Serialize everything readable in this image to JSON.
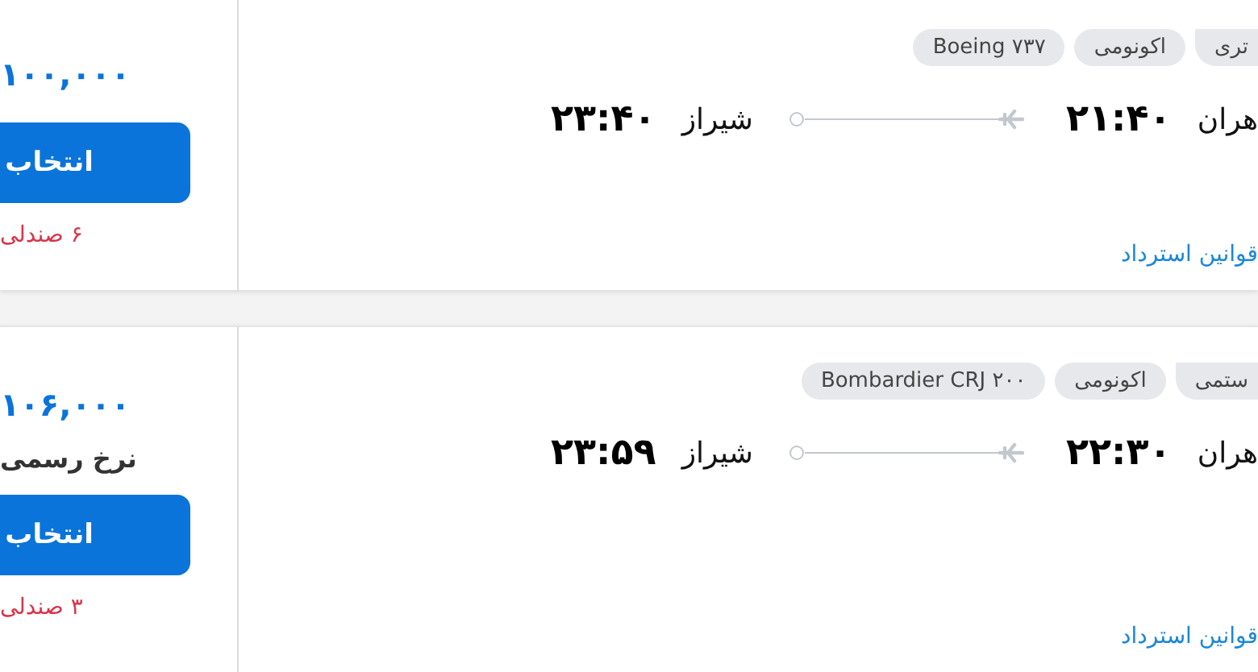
{
  "flights": [
    {
      "tags": [
        "تری",
        "اکونومی",
        "Boeing ۷۳۷"
      ],
      "origin": {
        "city": "هران",
        "time": "۲۱:۴۰"
      },
      "destination": {
        "city": "شیراز",
        "time": "۲۳:۴۰"
      },
      "refund_link": "قوانین استرداد",
      "price": "۱۰۰,۰۰۰",
      "select_button": "انتخاب",
      "seats_left": "۶ صندلی"
    },
    {
      "tags": [
        "ستمی",
        "اکونومی",
        "Bombardier CRJ ۲۰۰"
      ],
      "origin": {
        "city": "هران",
        "time": "۲۲:۳۰"
      },
      "destination": {
        "city": "شیراز",
        "time": "۲۳:۵۹"
      },
      "refund_link": "قوانین استرداد",
      "price": "۱۰۶,۰۰۰",
      "fare_note": "نرخ رسمی",
      "select_button": "انتخاب",
      "seats_left": "۳ صندلی"
    }
  ]
}
